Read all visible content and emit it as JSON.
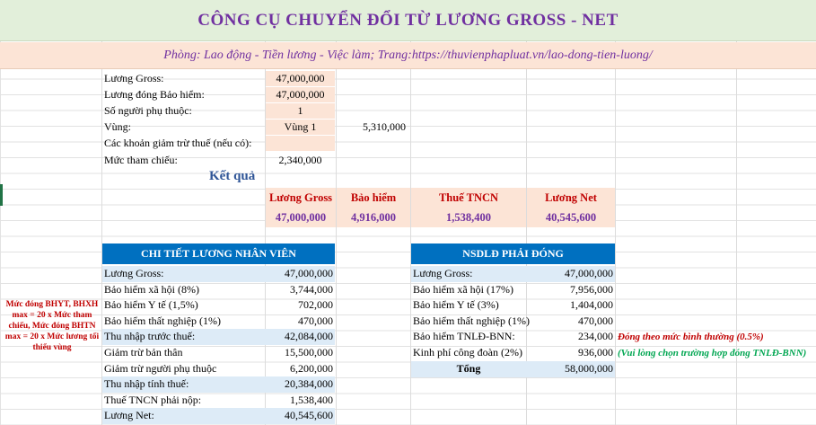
{
  "header": {
    "title": "CÔNG CỤ CHUYỂN ĐỔI TỪ LƯƠNG GROSS - NET",
    "subtitle": "Phòng: Lao động - Tiền lương - Việc làm; Trang:https://thuvienphapluat.vn/lao-dong-tien-luong/"
  },
  "inputs": {
    "gross_label": "Lương Gross:",
    "gross_value": "47,000,000",
    "insurance_salary_label": "Lương đóng Bảo hiểm:",
    "insurance_salary_value": "47,000,000",
    "dependents_label": "Số người phụ thuộc:",
    "dependents_value": "1",
    "region_label": "Vùng:",
    "region_value": "Vùng 1",
    "region_min_wage": "5,310,000",
    "deductions_label": "Các khoản giảm trừ thuế (nếu có):",
    "deductions_value": "",
    "reference_label": "Mức tham chiếu:",
    "reference_value": "2,340,000"
  },
  "result": {
    "heading": "Kết quả",
    "headers": [
      "Lương Gross",
      "Bảo hiểm",
      "Thuế TNCN",
      "Lương Net"
    ],
    "values": [
      "47,000,000",
      "4,916,000",
      "1,538,400",
      "40,545,600"
    ]
  },
  "employee_table": {
    "title": "CHI TIẾT LƯƠNG NHÂN VIÊN",
    "rows": [
      {
        "label": "Lương Gross:",
        "value": "47,000,000",
        "shaded": true
      },
      {
        "label": "Bảo hiểm xã hội (8%)",
        "value": "3,744,000",
        "shaded": false
      },
      {
        "label": "Bảo hiểm Y tế (1,5%)",
        "value": "702,000",
        "shaded": false
      },
      {
        "label": "Bảo hiểm thất nghiệp (1%)",
        "value": "470,000",
        "shaded": false
      },
      {
        "label": "Thu nhập trước thuế:",
        "value": "42,084,000",
        "shaded": true
      },
      {
        "label": "Giảm trừ bản thân",
        "value": "15,500,000",
        "shaded": false
      },
      {
        "label": "Giảm trừ người phụ thuộc",
        "value": "6,200,000",
        "shaded": false
      },
      {
        "label": "Thu nhập tính thuế:",
        "value": "20,384,000",
        "shaded": true
      },
      {
        "label": "Thuế TNCN phải nộp:",
        "value": "1,538,400",
        "shaded": false
      },
      {
        "label": "Lương Net:",
        "value": "40,545,600",
        "shaded": true
      }
    ]
  },
  "employer_table": {
    "title": "NSDLĐ PHẢI ĐÓNG",
    "rows": [
      {
        "label": "Lương Gross:",
        "value": "47,000,000",
        "shaded": true
      },
      {
        "label": "Bảo hiểm xã hội (17%)",
        "value": "7,956,000",
        "shaded": false
      },
      {
        "label": "Bảo hiểm Y tế (3%)",
        "value": "1,404,000",
        "shaded": false
      },
      {
        "label": "Bảo hiểm thất nghiệp (1%)",
        "value": "470,000",
        "shaded": false
      },
      {
        "label": "Bảo hiểm TNLĐ-BNN:",
        "value": "234,000",
        "shaded": false
      },
      {
        "label": "Kinh phí công đoàn (2%)",
        "value": "936,000",
        "shaded": false
      }
    ],
    "total_label": "Tổng",
    "total_value": "58,000,000"
  },
  "notes": {
    "left": "Mức đóng BHYT, BHXH max = 20 x Mức tham chiếu, Mức đóng BHTN max = 20 x Mức lương tối thiểu vùng",
    "tnld": "Đóng theo mức bình thường (0.5%)",
    "union": "(Vui lòng chọn trường hợp đóng TNLĐ-BNN)"
  },
  "colors": {
    "title": "#7030a0",
    "header_blue": "#0070c0",
    "accent_red": "#c00000",
    "accent_green": "#00a651",
    "input_fill": "#fce4d6",
    "shade_fill": "#ddebf7"
  }
}
